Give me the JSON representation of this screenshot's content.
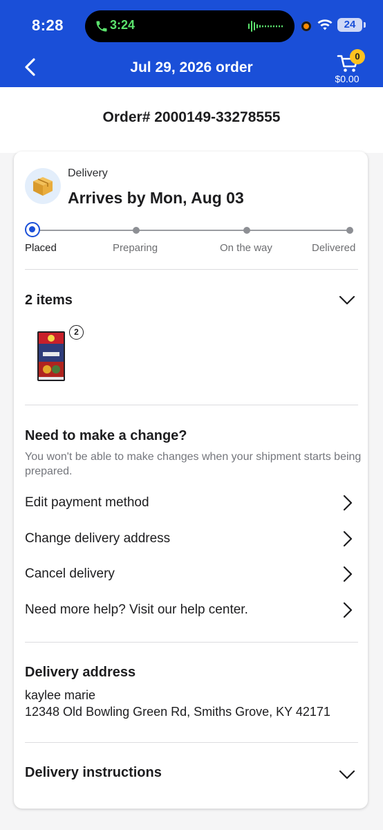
{
  "status_bar": {
    "time": "8:28",
    "call_time": "3:24",
    "battery": "24"
  },
  "header": {
    "title": "Jul 29, 2026 order",
    "cart_count": "0",
    "cart_total": "$0.00",
    "brand_color": "#1a4fd8"
  },
  "order": {
    "number": "Order# 2000149-33278555"
  },
  "delivery": {
    "label": "Delivery",
    "arrives": "Arrives by Mon, Aug 03",
    "steps": [
      "Placed",
      "Preparing",
      "On the way",
      "Delivered"
    ],
    "current_step": "Placed"
  },
  "items": {
    "title": "2 items",
    "quantity": "2"
  },
  "change": {
    "title": "Need to make a change?",
    "subtitle": "You won't be able to make changes when your shipment starts being prepared.",
    "actions": [
      "Edit payment method",
      "Change delivery address",
      "Cancel delivery",
      "Need more help? Visit our help center."
    ]
  },
  "address": {
    "title": "Delivery address",
    "name": "kaylee marie",
    "line": "12348 Old Bowling Green Rd, Smiths Grove, KY 42171"
  },
  "instructions": {
    "title": "Delivery instructions"
  }
}
